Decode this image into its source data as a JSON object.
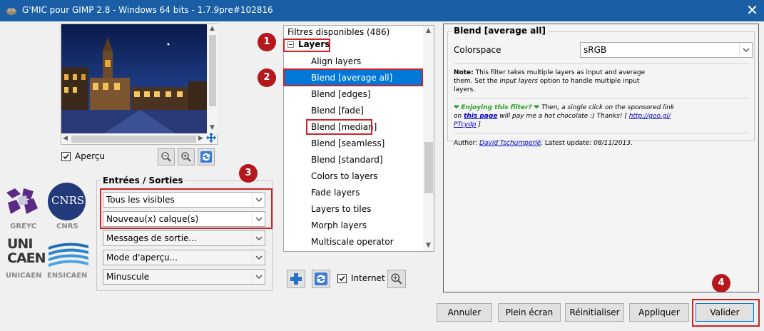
{
  "window": {
    "title": "G'MIC pour GIMP 2.8 - Windows 64 bits - 1.7.9pre#102816",
    "close": "✕"
  },
  "preview": {
    "apercu_label": "Aperçu",
    "apercu_checked": true
  },
  "logos": {
    "greyc": "GREYC",
    "cnrs": "CNRS",
    "cnrs_mark": "CNRS",
    "unicaen": "UNICAEN",
    "unicaen_mark": "UNI CAEN",
    "ensicaen": "ENSICAEN"
  },
  "io": {
    "title": "Entrées / Sorties",
    "input_layers": "Tous les visibles",
    "output_mode": "Nouveau(x) calque(s)",
    "output_messages": "Messages de sortie...",
    "preview_mode": "Mode d'aperçu...",
    "preview_size": "Minuscule"
  },
  "badges": {
    "b1": "1",
    "b2": "2",
    "b3": "3",
    "b4": "4"
  },
  "filters": {
    "header": "Filtres disponibles (486)",
    "category": "Layers",
    "items": [
      "Align layers",
      "Blend [average all]",
      "Blend [edges]",
      "Blend [fade]",
      "Blend [median]",
      "Blend [seamless]",
      "Blend [standard]",
      "Colors to layers",
      "Fade layers",
      "Layers to tiles",
      "Morph layers",
      "Multiscale operator"
    ],
    "selected_index": 1,
    "internet_label": "Internet",
    "internet_checked": true
  },
  "detail": {
    "title": "Blend [average all]",
    "colorspace_label": "Colorspace",
    "colorspace_value": "sRGB",
    "note_bold": "Note:",
    "note_1": " This filter takes multiple layers as input and average",
    "note_2a": "them. Set the ",
    "note_2b": "Input layers",
    "note_2c": " option to handle multiple input",
    "note_3": "layers.",
    "enjoy": "Enjoying this filter?",
    "then": " Then, a single click on the sponsored link",
    "on": "on ",
    "this_page": "this page",
    "will_pay": " will pay me a hot chocolate :) Thanks! [ ",
    "url_1": "http://goo.gl/",
    "url_2": "PTcydp",
    "close_bracket": " ]",
    "author_label": "Author: ",
    "author_name": "David Tschumperlé",
    "latest": ".     Latest update: ",
    "update_date": "08/11/2013",
    "period": "."
  },
  "buttons": {
    "annuler": "Annuler",
    "plein_ecran": "Plein écran",
    "reinitialiser": "Réinitialiser",
    "appliquer": "Appliquer",
    "valider": "Valider"
  },
  "colors": {
    "titlebar": "#1a5ea6",
    "selection": "#0078d7",
    "highlight_red": "#d32024",
    "badge": "#b4171c",
    "heart_green": "#2aa12a"
  }
}
